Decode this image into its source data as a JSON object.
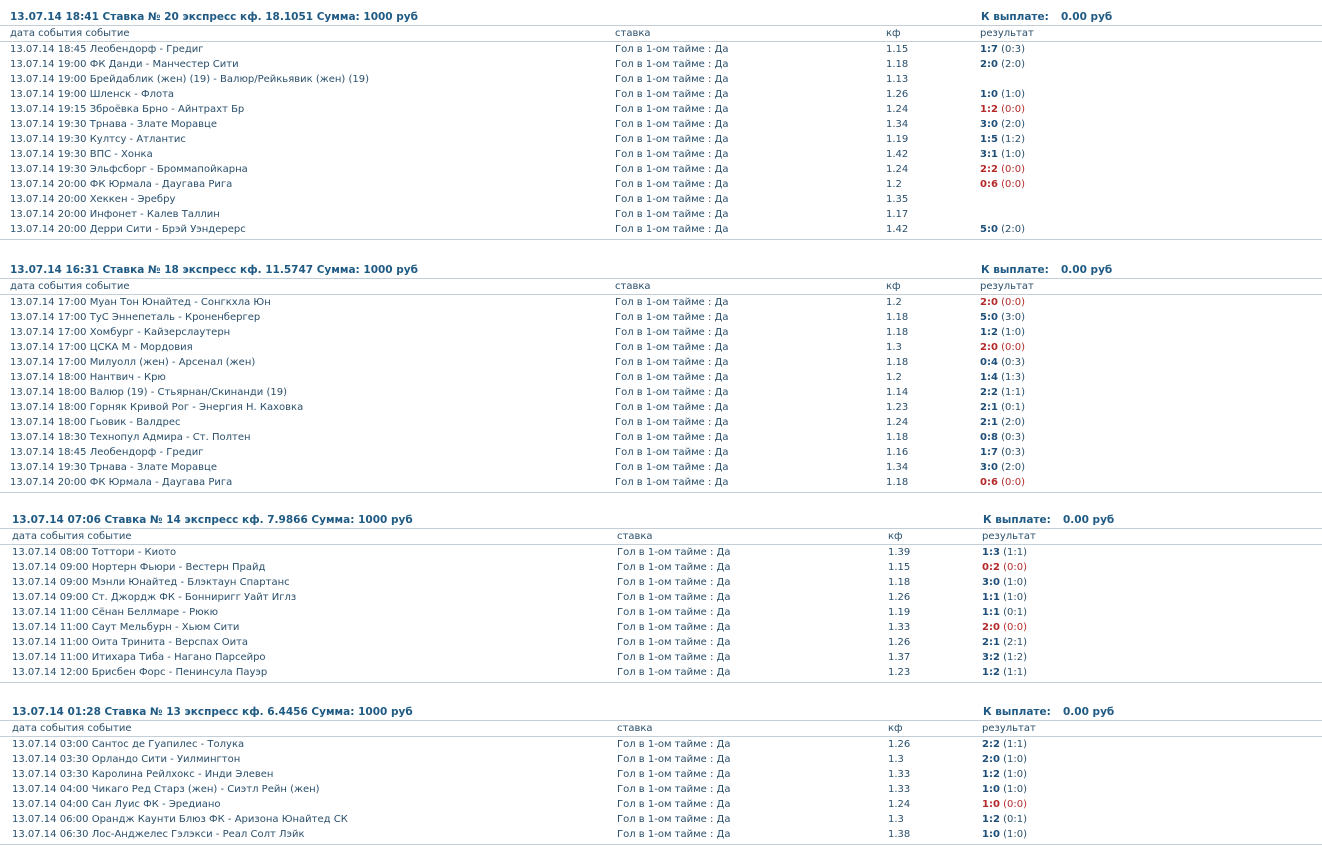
{
  "columns": {
    "date_event": "дата события событие",
    "stake": "ставка",
    "kf": "кф",
    "result": "результат"
  },
  "payout_label": "К выплате:",
  "bets": [
    {
      "header": "13.07.14 18:41  Ставка № 20  экспресс кф. 18.1051  Сумма: 1000 руб",
      "payout": "0.00 руб",
      "rows": [
        {
          "dt": "13.07.14 18:45 Леобендорф - Гредиг",
          "stake": "Гол в 1-ом тайме : Да",
          "kf": "1.15",
          "score": "1:7",
          "ht": "(0:3)",
          "lose": false
        },
        {
          "dt": "13.07.14 19:00 ФК Данди - Манчестер Сити",
          "stake": "Гол в 1-ом тайме : Да",
          "kf": "1.18",
          "score": "2:0",
          "ht": "(2:0)",
          "lose": false
        },
        {
          "dt": "13.07.14 19:00 Брейдаблик (жен) (19) - Валюр/Рейкьявик (жен) (19)",
          "stake": "Гол в 1-ом тайме : Да",
          "kf": "1.13",
          "score": "",
          "ht": "",
          "lose": false
        },
        {
          "dt": "13.07.14 19:00 Шленск - Флота",
          "stake": "Гол в 1-ом тайме : Да",
          "kf": "1.26",
          "score": "1:0",
          "ht": "(1:0)",
          "lose": false
        },
        {
          "dt": "13.07.14 19:15 Зброёвка Брно - Айнтрахт Бр",
          "stake": "Гол в 1-ом тайме : Да",
          "kf": "1.24",
          "score": "1:2",
          "ht": "(0:0)",
          "lose": true
        },
        {
          "dt": "13.07.14 19:30 Трнава - Злате Моравце",
          "stake": "Гол в 1-ом тайме : Да",
          "kf": "1.34",
          "score": "3:0",
          "ht": "(2:0)",
          "lose": false
        },
        {
          "dt": "13.07.14 19:30 Култсу - Атлантис",
          "stake": "Гол в 1-ом тайме : Да",
          "kf": "1.19",
          "score": "1:5",
          "ht": "(1:2)",
          "lose": false
        },
        {
          "dt": "13.07.14 19:30 ВПС - Хонка",
          "stake": "Гол в 1-ом тайме : Да",
          "kf": "1.42",
          "score": "3:1",
          "ht": "(1:0)",
          "lose": false
        },
        {
          "dt": "13.07.14 19:30 Эльфсборг - Броммапойкарна",
          "stake": "Гол в 1-ом тайме : Да",
          "kf": "1.24",
          "score": "2:2",
          "ht": "(0:0)",
          "lose": true
        },
        {
          "dt": "13.07.14 20:00 ФК Юрмала - Даугава Рига",
          "stake": "Гол в 1-ом тайме : Да",
          "kf": "1.2",
          "score": "0:6",
          "ht": "(0:0)",
          "lose": true
        },
        {
          "dt": "13.07.14 20:00 Хеккен - Эребру",
          "stake": "Гол в 1-ом тайме : Да",
          "kf": "1.35",
          "score": "",
          "ht": "",
          "lose": false
        },
        {
          "dt": "13.07.14 20:00 Инфонет - Калев Таллин",
          "stake": "Гол в 1-ом тайме : Да",
          "kf": "1.17",
          "score": "",
          "ht": "",
          "lose": false
        },
        {
          "dt": "13.07.14 20:00 Дерри Сити - Брэй Уэндерерс",
          "stake": "Гол в 1-ом тайме : Да",
          "kf": "1.42",
          "score": "5:0",
          "ht": "(2:0)",
          "lose": false
        }
      ]
    },
    {
      "header": "13.07.14 16:31  Ставка № 18  экспресс кф. 11.5747  Сумма: 1000 руб",
      "payout": "0.00 руб",
      "rows": [
        {
          "dt": "13.07.14 17:00 Муан Тон Юнайтед - Сонгкхла Юн",
          "stake": "Гол в 1-ом тайме : Да",
          "kf": "1.2",
          "score": "2:0",
          "ht": "(0:0)",
          "lose": true
        },
        {
          "dt": "13.07.14 17:00 ТуС Эннепеталь - Кроненбергер",
          "stake": "Гол в 1-ом тайме : Да",
          "kf": "1.18",
          "score": "5:0",
          "ht": "(3:0)",
          "lose": false
        },
        {
          "dt": "13.07.14 17:00 Хомбург - Кайзерслаутерн",
          "stake": "Гол в 1-ом тайме : Да",
          "kf": "1.18",
          "score": "1:2",
          "ht": "(1:0)",
          "lose": false
        },
        {
          "dt": "13.07.14 17:00 ЦСКА М - Мордовия",
          "stake": "Гол в 1-ом тайме : Да",
          "kf": "1.3",
          "score": "2:0",
          "ht": "(0:0)",
          "lose": true
        },
        {
          "dt": "13.07.14 17:00 Милуолл (жен) - Арсенал (жен)",
          "stake": "Гол в 1-ом тайме : Да",
          "kf": "1.18",
          "score": "0:4",
          "ht": "(0:3)",
          "lose": false
        },
        {
          "dt": "13.07.14 18:00 Нантвич - Крю",
          "stake": "Гол в 1-ом тайме : Да",
          "kf": "1.2",
          "score": "1:4",
          "ht": "(1:3)",
          "lose": false
        },
        {
          "dt": "13.07.14 18:00 Валюр (19) - Стьярнан/Скинанди (19)",
          "stake": "Гол в 1-ом тайме : Да",
          "kf": "1.14",
          "score": "2:2",
          "ht": "(1:1)",
          "lose": false
        },
        {
          "dt": "13.07.14 18:00 Горняк Кривой Рог - Энергия Н. Каховка",
          "stake": "Гол в 1-ом тайме : Да",
          "kf": "1.23",
          "score": "2:1",
          "ht": "(0:1)",
          "lose": false
        },
        {
          "dt": "13.07.14 18:00 Гьовик - Валдрес",
          "stake": "Гол в 1-ом тайме : Да",
          "kf": "1.24",
          "score": "2:1",
          "ht": "(2:0)",
          "lose": false
        },
        {
          "dt": "13.07.14 18:30 Технопул Адмира - Ст. Полтен",
          "stake": "Гол в 1-ом тайме : Да",
          "kf": "1.18",
          "score": "0:8",
          "ht": "(0:3)",
          "lose": false
        },
        {
          "dt": "13.07.14 18:45 Леобендорф - Гредиг",
          "stake": "Гол в 1-ом тайме : Да",
          "kf": "1.16",
          "score": "1:7",
          "ht": "(0:3)",
          "lose": false
        },
        {
          "dt": "13.07.14 19:30 Трнава - Злате Моравце",
          "stake": "Гол в 1-ом тайме : Да",
          "kf": "1.34",
          "score": "3:0",
          "ht": "(2:0)",
          "lose": false
        },
        {
          "dt": "13.07.14 20:00 ФК Юрмала - Даугава Рига",
          "stake": "Гол в 1-ом тайме : Да",
          "kf": "1.18",
          "score": "0:6",
          "ht": "(0:0)",
          "lose": true
        }
      ]
    },
    {
      "header": "13.07.14 07:06  Ставка № 14  экспресс кф. 7.9866  Сумма: 1000 руб",
      "payout": "0.00 руб",
      "rows": [
        {
          "dt": "13.07.14 08:00 Тоттори - Киото",
          "stake": "Гол в 1-ом тайме : Да",
          "kf": "1.39",
          "score": "1:3",
          "ht": "(1:1)",
          "lose": false
        },
        {
          "dt": "13.07.14 09:00 Нортерн Фьюри - Вестерн Прайд",
          "stake": "Гол в 1-ом тайме : Да",
          "kf": "1.15",
          "score": "0:2",
          "ht": "(0:0)",
          "lose": true
        },
        {
          "dt": "13.07.14 09:00 Мэнли Юнайтед - Блэктаун Спартанс",
          "stake": "Гол в 1-ом тайме : Да",
          "kf": "1.18",
          "score": "3:0",
          "ht": "(1:0)",
          "lose": false
        },
        {
          "dt": "13.07.14 09:00 Ст. Джордж ФК - Бонниригг Уайт Иглз",
          "stake": "Гол в 1-ом тайме : Да",
          "kf": "1.26",
          "score": "1:1",
          "ht": "(1:0)",
          "lose": false
        },
        {
          "dt": "13.07.14 11:00 Сёнан Беллмаре - Рюкю",
          "stake": "Гол в 1-ом тайме : Да",
          "kf": "1.19",
          "score": "1:1",
          "ht": "(0:1)",
          "lose": false
        },
        {
          "dt": "13.07.14 11:00 Саут Мельбурн - Хьюм Сити",
          "stake": "Гол в 1-ом тайме : Да",
          "kf": "1.33",
          "score": "2:0",
          "ht": "(0:0)",
          "lose": true
        },
        {
          "dt": "13.07.14 11:00 Оита Тринита - Верспах Оита",
          "stake": "Гол в 1-ом тайме : Да",
          "kf": "1.26",
          "score": "2:1",
          "ht": "(2:1)",
          "lose": false
        },
        {
          "dt": "13.07.14 11:00 Итихара Тиба - Нагано Парсейро",
          "stake": "Гол в 1-ом тайме : Да",
          "kf": "1.37",
          "score": "3:2",
          "ht": "(1:2)",
          "lose": false
        },
        {
          "dt": "13.07.14 12:00 Брисбен Форс - Пенинсула Пауэр",
          "stake": "Гол в 1-ом тайме : Да",
          "kf": "1.23",
          "score": "1:2",
          "ht": "(1:1)",
          "lose": false
        }
      ]
    },
    {
      "header": "13.07.14 01:28  Ставка № 13  экспресс кф. 6.4456  Сумма: 1000 руб",
      "payout": "0.00 руб",
      "rows": [
        {
          "dt": "13.07.14 03:00 Сантос де Гуапилес - Толука",
          "stake": "Гол в 1-ом тайме : Да",
          "kf": "1.26",
          "score": "2:2",
          "ht": "(1:1)",
          "lose": false
        },
        {
          "dt": "13.07.14 03:30 Орландо Сити - Уилмингтон",
          "stake": "Гол в 1-ом тайме : Да",
          "kf": "1.3",
          "score": "2:0",
          "ht": "(1:0)",
          "lose": false
        },
        {
          "dt": "13.07.14 03:30 Каролина Рейлхокс - Инди Элевен",
          "stake": "Гол в 1-ом тайме : Да",
          "kf": "1.33",
          "score": "1:2",
          "ht": "(1:0)",
          "lose": false
        },
        {
          "dt": "13.07.14 04:00 Чикаго Ред Старз (жен) - Сиэтл Рейн (жен)",
          "stake": "Гол в 1-ом тайме : Да",
          "kf": "1.33",
          "score": "1:0",
          "ht": "(1:0)",
          "lose": false
        },
        {
          "dt": "13.07.14 04:00 Сан Луис ФК - Эредиано",
          "stake": "Гол в 1-ом тайме : Да",
          "kf": "1.24",
          "score": "1:0",
          "ht": "(0:0)",
          "lose": true
        },
        {
          "dt": "13.07.14 06:00 Орандж Каунти Блюз ФК - Аризона Юнайтед СК",
          "stake": "Гол в 1-ом тайме : Да",
          "kf": "1.3",
          "score": "1:2",
          "ht": "(0:1)",
          "lose": false
        },
        {
          "dt": "13.07.14 06:30 Лос-Анджелес Гэлэкси - Реал Солт Лэйк",
          "stake": "Гол в 1-ом тайме : Да",
          "kf": "1.38",
          "score": "1:0",
          "ht": "(1:0)",
          "lose": false
        }
      ]
    }
  ]
}
